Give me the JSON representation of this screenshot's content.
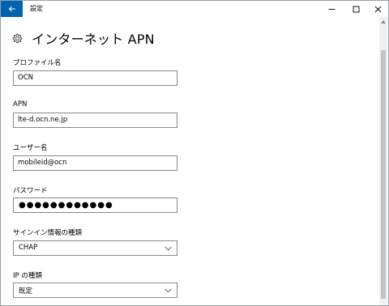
{
  "window": {
    "title": "設定",
    "back_icon": "back-arrow-icon",
    "accent": "#0063b1"
  },
  "page": {
    "title": "インターネット APN",
    "icon": "gear-icon"
  },
  "fields": {
    "profile_name": {
      "label": "プロファイル名",
      "value": "OCN"
    },
    "apn": {
      "label": "APN",
      "value": "lte-d.ocn.ne.jp"
    },
    "username": {
      "label": "ユーザー名",
      "value": "mobileid@ocn"
    },
    "password": {
      "label": "パスワード",
      "masked": "●●●●●●●●●●●●"
    },
    "signin_type": {
      "label": "サインイン情報の種類",
      "selected": "CHAP"
    },
    "ip_type": {
      "label": "IP の種類",
      "selected": "既定"
    }
  }
}
